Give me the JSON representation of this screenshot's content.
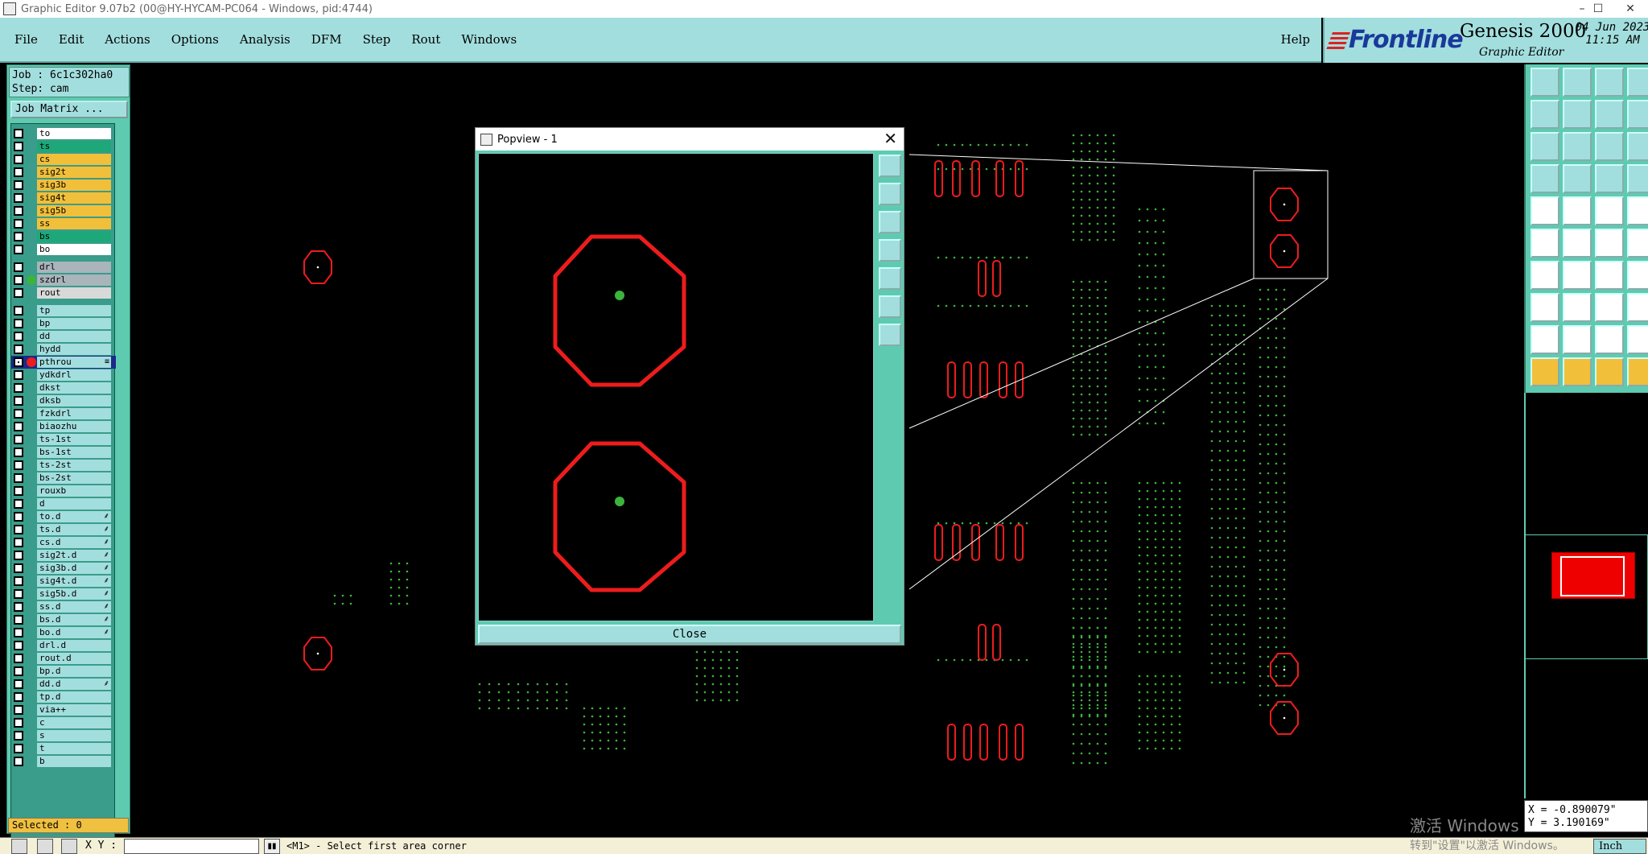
{
  "window": {
    "title": "Graphic Editor 9.07b2 (00@HY-HYCAM-PC064 - Windows, pid:4744)",
    "minimize": "–",
    "maximize": "☐",
    "close": "✕"
  },
  "menubar": {
    "items": [
      {
        "name": "file",
        "label": "File"
      },
      {
        "name": "edit",
        "label": "Edit"
      },
      {
        "name": "actions",
        "label": "Actions"
      },
      {
        "name": "options",
        "label": "Options"
      },
      {
        "name": "analysis",
        "label": "Analysis"
      },
      {
        "name": "dfm",
        "label": "DFM"
      },
      {
        "name": "step",
        "label": "Step"
      },
      {
        "name": "rout",
        "label": "Rout"
      },
      {
        "name": "windows",
        "label": "Windows"
      }
    ],
    "help": "Help"
  },
  "brand": {
    "logo": "Frontline",
    "product": "Genesis 2000",
    "subtitle": "Graphic Editor",
    "date": "04 Jun 2023",
    "time": "11:15 AM"
  },
  "job": {
    "job_line": "Job : 6c1c302ha0",
    "step_line": "Step: cam",
    "job_matrix": "Job Matrix ..."
  },
  "layers": [
    {
      "name": "to",
      "color": "#ffffff"
    },
    {
      "name": "ts",
      "color": "#1ea87a"
    },
    {
      "name": "cs",
      "color": "#f2bf3a"
    },
    {
      "name": "sig2t",
      "color": "#f2bf3a"
    },
    {
      "name": "sig3b",
      "color": "#f2bf3a"
    },
    {
      "name": "sig4t",
      "color": "#f2bf3a"
    },
    {
      "name": "sig5b",
      "color": "#f2bf3a"
    },
    {
      "name": "ss",
      "color": "#f2bf3a"
    },
    {
      "name": "bs",
      "color": "#1ea87a"
    },
    {
      "name": "bo",
      "color": "#ffffff"
    },
    {
      "name": "drl",
      "color": "#a9b4bb",
      "gap": true
    },
    {
      "name": "szdrl",
      "color": "#a9b4bb",
      "dot": "#3cb43c"
    },
    {
      "name": "rout",
      "color": "#d9d9d9"
    },
    {
      "name": "tp",
      "color": "#a3dede",
      "gap": true
    },
    {
      "name": "bp",
      "color": "#a3dede"
    },
    {
      "name": "dd",
      "color": "#a3dede"
    },
    {
      "name": "hydd",
      "color": "#a3dede"
    },
    {
      "name": "pthrou",
      "color": "#a3dede",
      "dot": "#ee1c1c",
      "active": true,
      "mark": "≡"
    },
    {
      "name": "ydkdrl",
      "color": "#a3dede"
    },
    {
      "name": "dkst",
      "color": "#a3dede"
    },
    {
      "name": "dksb",
      "color": "#a3dede"
    },
    {
      "name": "fzkdrl",
      "color": "#a3dede"
    },
    {
      "name": "biaozhu",
      "color": "#a3dede"
    },
    {
      "name": "ts-1st",
      "color": "#a3dede"
    },
    {
      "name": "bs-1st",
      "color": "#a3dede"
    },
    {
      "name": "ts-2st",
      "color": "#a3dede"
    },
    {
      "name": "bs-2st",
      "color": "#a3dede"
    },
    {
      "name": "rouxb",
      "color": "#a3dede"
    },
    {
      "name": "d",
      "color": "#a3dede"
    },
    {
      "name": "to.d",
      "color": "#a3dede",
      "mark": "⸙"
    },
    {
      "name": "ts.d",
      "color": "#a3dede",
      "mark": "⸙"
    },
    {
      "name": "cs.d",
      "color": "#a3dede",
      "mark": "⸙"
    },
    {
      "name": "sig2t.d",
      "color": "#a3dede",
      "mark": "⸙"
    },
    {
      "name": "sig3b.d",
      "color": "#a3dede",
      "mark": "⸙"
    },
    {
      "name": "sig4t.d",
      "color": "#a3dede",
      "mark": "⸙"
    },
    {
      "name": "sig5b.d",
      "color": "#a3dede",
      "mark": "⸙"
    },
    {
      "name": "ss.d",
      "color": "#a3dede",
      "mark": "⸙"
    },
    {
      "name": "bs.d",
      "color": "#a3dede",
      "mark": "⸙"
    },
    {
      "name": "bo.d",
      "color": "#a3dede",
      "mark": "⸙"
    },
    {
      "name": "drl.d",
      "color": "#a3dede"
    },
    {
      "name": "rout.d",
      "color": "#a3dede"
    },
    {
      "name": "bp.d",
      "color": "#a3dede"
    },
    {
      "name": "dd.d",
      "color": "#a3dede",
      "mark": "⸙"
    },
    {
      "name": "tp.d",
      "color": "#a3dede"
    },
    {
      "name": "via++",
      "color": "#a3dede"
    },
    {
      "name": "c",
      "color": "#a3dede"
    },
    {
      "name": "s",
      "color": "#a3dede"
    },
    {
      "name": "t",
      "color": "#a3dede"
    },
    {
      "name": "b",
      "color": "#a3dede"
    }
  ],
  "selected": "Selected : 0",
  "popview": {
    "title": "Popview - 1",
    "close_x": "✕",
    "close_button": "Close"
  },
  "coords": {
    "x": "X = -0.890079\"",
    "y": "Y = 3.190169\""
  },
  "watermark": {
    "line1": "激活 Windows",
    "line2": "转到\"设置\"以激活 Windows。"
  },
  "bottombar": {
    "xy_label": "X Y :",
    "xy_value": "",
    "prompt": "<M1> - Select first area corner",
    "units": "Inch"
  },
  "colors": {
    "pad_outline": "#ee1c1c",
    "drill_dot": "#3cb43c",
    "panel": "#5ecbb0",
    "menu": "#a3dede",
    "active_tool": "#f2bf3a"
  }
}
